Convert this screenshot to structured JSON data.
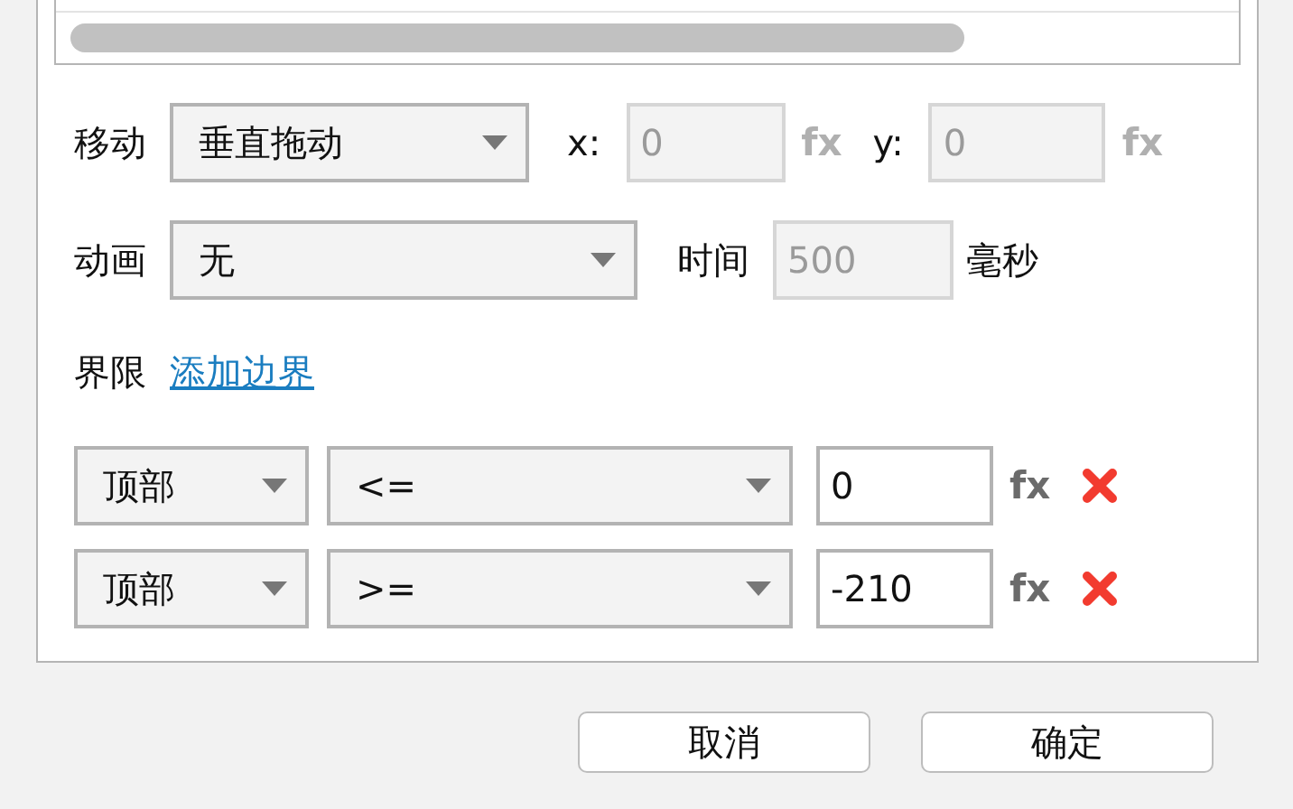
{
  "move": {
    "label": "移动",
    "mode": "垂直拖动",
    "coords": [
      {
        "label": "x:",
        "value": "0",
        "disabled": true,
        "fx": "fx"
      },
      {
        "label": "y:",
        "value": "0",
        "disabled": true,
        "fx": "fx"
      }
    ]
  },
  "animation": {
    "label": "动画",
    "value": "无",
    "time_label": "时间",
    "time": "500",
    "time_disabled": true,
    "unit": "毫秒"
  },
  "limits": {
    "label": "界限",
    "add_link": "添加边界"
  },
  "boundaries": [
    {
      "edge": "顶部",
      "operator": "<=",
      "value": "0",
      "fx": "fx"
    },
    {
      "edge": "顶部",
      "operator": ">=",
      "value": "-210",
      "fx": "fx"
    }
  ],
  "buttons": [
    "取消",
    "确定"
  ]
}
